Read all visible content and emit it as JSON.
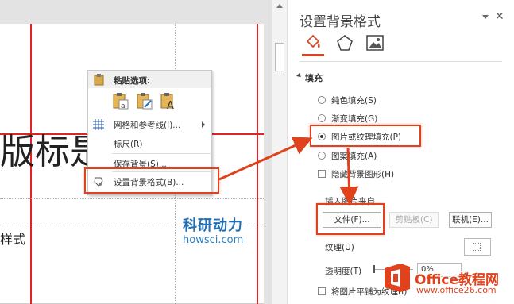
{
  "slide": {
    "title_fragment": "版标是",
    "subtitle_fragment": "样式"
  },
  "watermark": {
    "logo_text": "科研动力",
    "url_text": "howsci.com"
  },
  "context_menu": {
    "paste_options_label": "粘贴选项:",
    "items": [
      {
        "label": "网格和参考线(I)...",
        "icon": "grid-icon",
        "has_submenu": true
      },
      {
        "label": "标尺(R)",
        "icon": "",
        "has_submenu": false
      },
      {
        "label": "保存背景(S)...",
        "icon": "",
        "has_submenu": false
      },
      {
        "label": "设置背景格式(B)...",
        "icon": "format-background-icon",
        "has_submenu": false
      }
    ]
  },
  "pane": {
    "title": "设置背景格式",
    "tabs": [
      "fill-bucket-icon",
      "pentagon-icon",
      "picture-icon"
    ],
    "section_label": "填充",
    "fill_options": [
      {
        "label": "纯色填充(S)",
        "selected": false
      },
      {
        "label": "渐变填充(G)",
        "selected": false
      },
      {
        "label": "图片或纹理填充(P)",
        "selected": true
      },
      {
        "label": "图案填充(A)",
        "selected": false
      }
    ],
    "hide_background_graphics": "隐藏背景图形(H)",
    "insert_source_label": "插入图片来自",
    "file_button": "文件(F)...",
    "clipboard_button": "剪贴板(C)",
    "online_button": "联机(E)...",
    "texture_label": "纹理(U)",
    "transparency_label": "透明度(T)",
    "transparency_value": "0%",
    "tile_label": "将图片平铺为纹理(I)"
  },
  "badge": {
    "name": "Office教程网",
    "url": "www.office26.com"
  },
  "colors": {
    "guide_red": "#e32227",
    "highlight_orange": "#e0421e",
    "accent": "#d24726",
    "watermark_blue": "#1f6fb6"
  }
}
